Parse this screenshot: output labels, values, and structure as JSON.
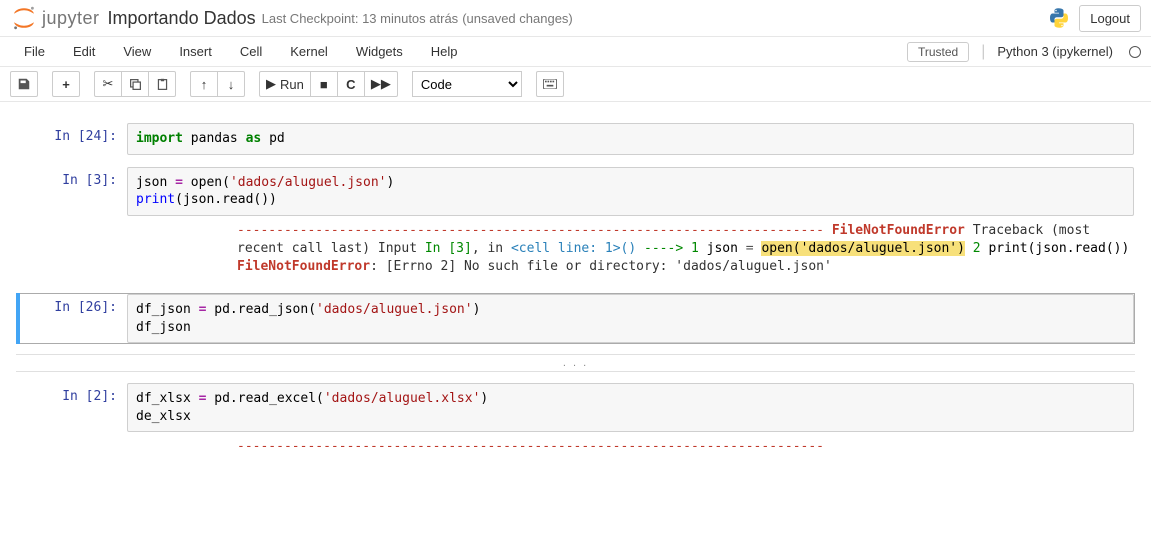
{
  "header": {
    "logo_text": "jupyter",
    "nb_title": "Importando Dados",
    "checkpoint": "Last Checkpoint: 13 minutos atrás",
    "unsaved": "(unsaved changes)",
    "logout": "Logout"
  },
  "menubar": {
    "items": [
      "File",
      "Edit",
      "View",
      "Insert",
      "Cell",
      "Kernel",
      "Widgets",
      "Help"
    ],
    "trusted": "Trusted",
    "kernel": "Python 3 (ipykernel)"
  },
  "toolbar": {
    "run_label": "Run",
    "celltype_value": "Code"
  },
  "cells": [
    {
      "prompt": "In [24]:",
      "code": {
        "t1": "import",
        "t2": " pandas ",
        "t3": "as",
        "t4": " pd"
      }
    },
    {
      "prompt": "In [3]:",
      "code": {
        "l1a": "json ",
        "l1b": "=",
        "l1c": " open(",
        "l1d": "'dados/aluguel.json'",
        "l1e": ")",
        "l2a": "print",
        "l2b": "(json.read())"
      },
      "error": {
        "dashes": "---------------------------------------------------------------------------",
        "name": "FileNotFoundError",
        "tb_label": "Traceback (most recent call last)",
        "input_in": "Input ",
        "in_num": "In [3]",
        "in_tail": ", in ",
        "cell_line": "<cell line: 1>",
        "paren": "()",
        "arrow": "----> 1 ",
        "ln1a": "json ",
        "ln1b": "=",
        "ln1c": " ",
        "hl": "open('dados/aluguel.json')",
        "line2_pre": "      2 ",
        "ln2": "print(json.read())",
        "final_name": "FileNotFoundError",
        "final_msg": ": [Errno 2] No such file or directory: 'dados/aluguel.json'"
      }
    },
    {
      "prompt": "In [26]:",
      "selected": true,
      "code": {
        "l1a": "df_json ",
        "l1b": "=",
        "l1c": " pd.read_json(",
        "l1d": "'dados/aluguel.json'",
        "l1e": ")",
        "l2": "df_json"
      },
      "collapser": ". . ."
    },
    {
      "prompt": "In [2]:",
      "code": {
        "l1a": "df_xlsx ",
        "l1b": "=",
        "l1c": " pd.read_excel(",
        "l1d": "'dados/aluguel.xlsx'",
        "l1e": ")",
        "l2": "de_xlsx"
      },
      "error_dashes": "---------------------------------------------------------------------------"
    }
  ]
}
